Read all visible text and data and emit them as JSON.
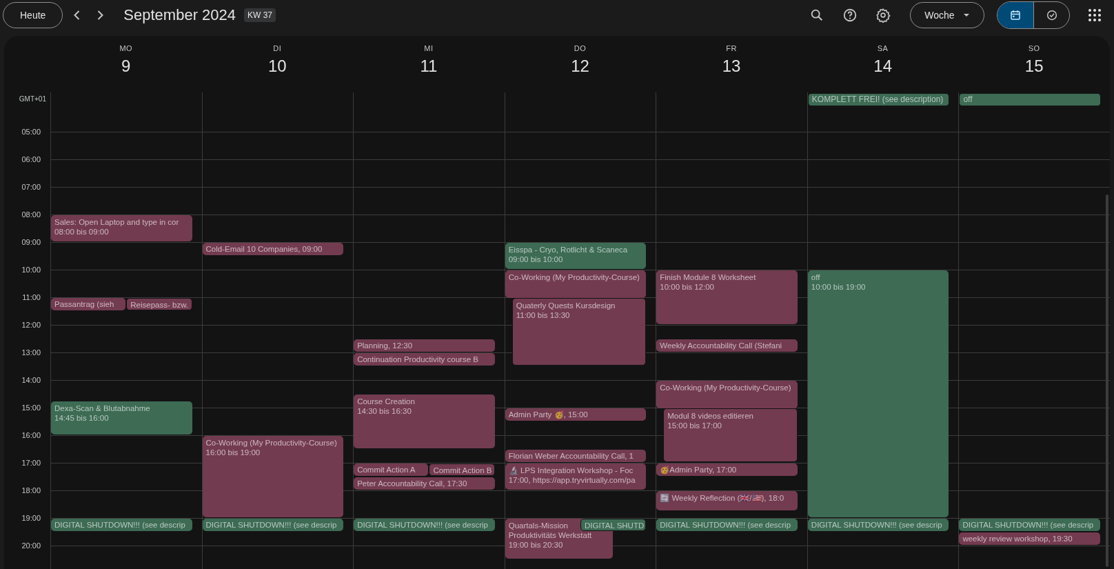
{
  "toolbar": {
    "today_button": "Heute",
    "title": "September 2024",
    "week_badge": "KW 37",
    "view_select": "Woche",
    "view_switch": [
      {
        "kind": "calendar",
        "selected": true
      },
      {
        "kind": "tasks",
        "selected": false
      }
    ]
  },
  "timezone": "GMT+01",
  "hours": [
    "05:00",
    "06:00",
    "07:00",
    "08:00",
    "09:00",
    "10:00",
    "11:00",
    "12:00",
    "13:00",
    "14:00",
    "15:00",
    "16:00",
    "17:00",
    "18:00",
    "19:00",
    "20:00"
  ],
  "days": [
    {
      "weekday": "MO",
      "date": "9",
      "events": [
        {
          "title": "Sales: Open Laptop and type in cor",
          "time": "08:00 bis 09:00",
          "color": "#733b4f"
        },
        {
          "title": "Passantrag (sieh",
          "color": "#733b4f"
        },
        {
          "title": "Reisepass- bzw.",
          "color": "#733b4f"
        },
        {
          "title": "Dexa-Scan & Blutabnahme",
          "time": "14:45 bis 16:00",
          "color": "#3d6b54"
        },
        {
          "title": "DIGITAL SHUTDOWN!!! (see descrip",
          "color": "#3d6b54"
        }
      ]
    },
    {
      "weekday": "DI",
      "date": "10",
      "events": [
        {
          "title": "Cold-Email 10 Companies, 09:00",
          "color": "#733b4f"
        },
        {
          "title": "Co-Working (My Productivity-Course)",
          "time": "16:00 bis 19:00",
          "color": "#733b4f"
        },
        {
          "title": "DIGITAL SHUTDOWN!!! (see descrip",
          "color": "#3d6b54"
        }
      ]
    },
    {
      "weekday": "MI",
      "date": "11",
      "events": [
        {
          "title": "Planning, 12:30",
          "color": "#733b4f"
        },
        {
          "title": "Continuation Productivity course B",
          "color": "#733b4f"
        },
        {
          "title": "Course Creation",
          "time": "14:30 bis 16:30",
          "color": "#733b4f"
        },
        {
          "title": "Commit Action A",
          "color": "#733b4f"
        },
        {
          "title": "Commit Action B",
          "color": "#733b4f"
        },
        {
          "title": "Peter Accountability Call, 17:30",
          "color": "#733b4f"
        },
        {
          "title": "DIGITAL SHUTDOWN!!! (see descrip",
          "color": "#3d6b54"
        }
      ]
    },
    {
      "weekday": "DO",
      "date": "12",
      "events": [
        {
          "title": "Eisspa - Cryo, Rotlicht & Scaneca",
          "time": "09:00 bis 10:00",
          "color": "#3d6b54"
        },
        {
          "title": "Co-Working (My Productivity-Course)",
          "color": "#733b4f"
        },
        {
          "title": "Quaterly Quests Kursdesign",
          "time": "11:00 bis 13:30",
          "color": "#733b4f"
        },
        {
          "title": "Admin Party 🥳, 15:00",
          "color": "#733b4f"
        },
        {
          "title": "Florian Weber Accountability Call, 1",
          "color": "#733b4f"
        },
        {
          "title": "🔬 LPS Integration Workshop - Foc",
          "time": "17:00, https://app.tryvirtually.com/pa",
          "color": "#733b4f"
        },
        {
          "title": "Quartals-Mission",
          "subtitle": "Produktivitäts Werkstatt",
          "time": "19:00 bis 20:30",
          "color": "#733b4f"
        },
        {
          "title": "DIGITAL SHUTD",
          "color": "#3d6b54"
        }
      ]
    },
    {
      "weekday": "FR",
      "date": "13",
      "events": [
        {
          "title": "Finish Module 8 Worksheet",
          "time": "10:00 bis 12:00",
          "color": "#733b4f"
        },
        {
          "title": "Weekly Accountability Call (Stefani",
          "color": "#733b4f"
        },
        {
          "title": "Co-Working (My Productivity-Course)",
          "color": "#733b4f"
        },
        {
          "title": "Modul 8 videos editieren",
          "time": "15:00 bis 17:00",
          "color": "#733b4f"
        },
        {
          "title": "🥳Admin Party, 17:00",
          "color": "#733b4f"
        },
        {
          "title": "🔄 Weekly Reflection (🇬🇧/🇺🇸), 18:0",
          "color": "#733b4f"
        },
        {
          "title": "DIGITAL SHUTDOWN!!! (see descrip",
          "color": "#3d6b54"
        }
      ]
    },
    {
      "weekday": "SA",
      "date": "14",
      "all_day": [
        {
          "title": "KOMPLETT FREI! (see description)",
          "color": "#3d6b54"
        }
      ],
      "events": [
        {
          "title": "off",
          "time": "10:00 bis 19:00",
          "color": "#3d6b54"
        },
        {
          "title": "DIGITAL SHUTDOWN!!! (see descrip",
          "color": "#3d6b54"
        }
      ]
    },
    {
      "weekday": "SO",
      "date": "15",
      "all_day": [
        {
          "title": "off",
          "color": "#3d6b54"
        }
      ],
      "events": [
        {
          "title": "DIGITAL SHUTDOWN!!! (see descrip",
          "color": "#3d6b54"
        },
        {
          "title": "weekly review workshop, 19:30",
          "color": "#733b4f"
        }
      ]
    }
  ]
}
